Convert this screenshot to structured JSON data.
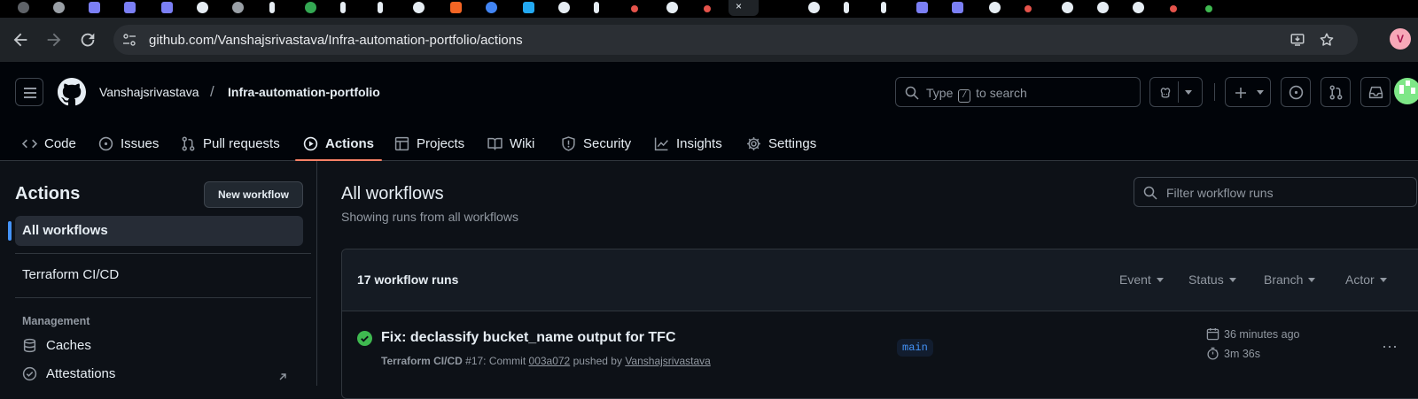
{
  "browser": {
    "url": "github.com/Vanshajsrivastava/Infra-automation-portfolio/actions",
    "profile_initial": "V",
    "active_tab_close": "×"
  },
  "header": {
    "owner": "Vanshajsrivastava",
    "separator": "/",
    "repo": "Infra-automation-portfolio",
    "search_prefix": "Type",
    "search_key": "/",
    "search_suffix": "to search"
  },
  "repo_tabs": [
    {
      "label": "Code",
      "icon": "code-icon"
    },
    {
      "label": "Issues",
      "icon": "issue-icon"
    },
    {
      "label": "Pull requests",
      "icon": "pull-request-icon"
    },
    {
      "label": "Actions",
      "icon": "play-icon",
      "active": true
    },
    {
      "label": "Projects",
      "icon": "table-icon"
    },
    {
      "label": "Wiki",
      "icon": "book-icon"
    },
    {
      "label": "Security",
      "icon": "shield-icon"
    },
    {
      "label": "Insights",
      "icon": "graph-icon"
    },
    {
      "label": "Settings",
      "icon": "gear-icon"
    }
  ],
  "sidebar": {
    "title": "Actions",
    "new_workflow": "New workflow",
    "all_workflows": "All workflows",
    "workflows": [
      "Terraform CI/CD"
    ],
    "management_heading": "Management",
    "management_items": [
      "Caches",
      "Attestations"
    ]
  },
  "main": {
    "title": "All workflows",
    "subtitle": "Showing runs from all workflows",
    "filter_placeholder": "Filter workflow runs",
    "runs_count": "17 workflow runs",
    "filters": [
      "Event",
      "Status",
      "Branch",
      "Actor"
    ]
  },
  "runs": [
    {
      "status": "success",
      "title": "Fix: declassify bucket_name output for TFC",
      "workflow": "Terraform CI/CD",
      "number": "#17",
      "commit_prefix": ": Commit",
      "commit": "003a072",
      "pushed_by": "pushed by",
      "actor": "Vanshajsrivastava",
      "branch": "main",
      "time_ago": "36 minutes ago",
      "duration": "3m 36s"
    }
  ],
  "colors": {
    "accent_underline": "#f78166",
    "success": "#3fb950",
    "link_blue": "#4493f8"
  }
}
